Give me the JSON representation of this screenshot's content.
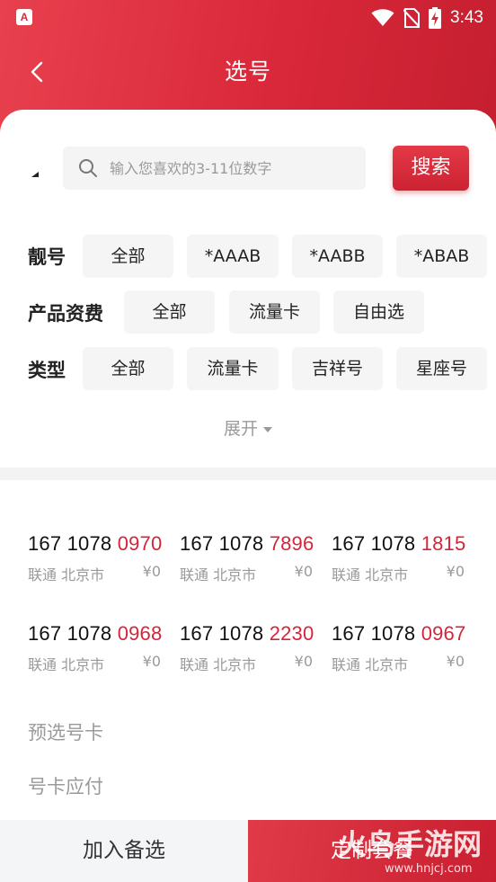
{
  "status_bar": {
    "time": "3:43",
    "app_icon_letter": "A"
  },
  "nav": {
    "title": "选号"
  },
  "search": {
    "placeholder": "输入您喜欢的3-11位数字",
    "button_label": "搜索"
  },
  "filters": [
    {
      "label": "靓号",
      "chips": [
        "全部",
        "*AAAB",
        "*AABB",
        "*ABAB"
      ]
    },
    {
      "label": "产品资费",
      "chips": [
        "全部",
        "流量卡",
        "自由选"
      ]
    },
    {
      "label": "类型",
      "chips": [
        "全部",
        "流量卡",
        "吉祥号",
        "星座号"
      ]
    }
  ],
  "expand_label": "展开",
  "numbers": [
    {
      "prefix": "167 1078 ",
      "tail": "0970",
      "carrier": "联通",
      "city": "北京市",
      "price": "¥0"
    },
    {
      "prefix": "167 1078 ",
      "tail": "7896",
      "carrier": "联通",
      "city": "北京市",
      "price": "¥0"
    },
    {
      "prefix": "167 1078 ",
      "tail": "1815",
      "carrier": "联通",
      "city": "北京市",
      "price": "¥0"
    },
    {
      "prefix": "167 1078 ",
      "tail": "0968",
      "carrier": "联通",
      "city": "北京市",
      "price": "¥0"
    },
    {
      "prefix": "167 1078 ",
      "tail": "2230",
      "carrier": "联通",
      "city": "北京市",
      "price": "¥0"
    },
    {
      "prefix": "167 1078 ",
      "tail": "0967",
      "carrier": "联通",
      "city": "北京市",
      "price": "¥0"
    }
  ],
  "summary": {
    "preselected_label": "预选号卡",
    "payable_label": "号卡应付"
  },
  "bottom": {
    "add_label": "加入备选",
    "custom_label": "定制套餐"
  },
  "watermark": {
    "brand": "火鸟手游网",
    "url": "www.hnjcj.com"
  },
  "colors": {
    "brand_red": "#d9283a",
    "highlight_red": "#d3263a",
    "muted_gray": "#9a9a9a"
  }
}
